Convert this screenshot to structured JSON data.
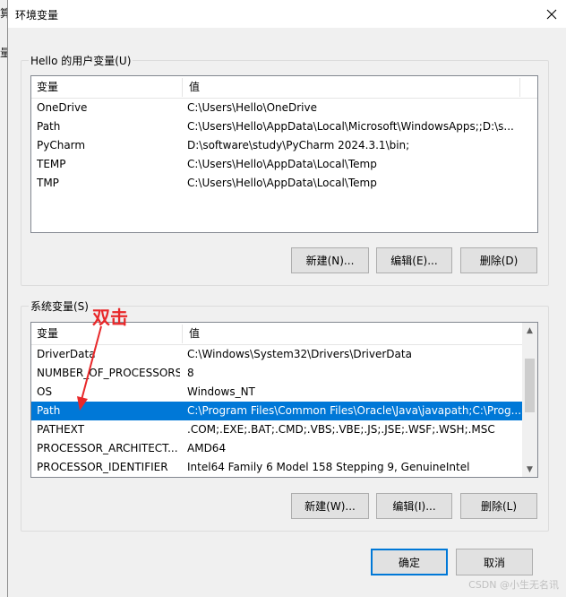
{
  "dialog": {
    "title": "环境变量",
    "ok_label": "确定",
    "cancel_label": "取消"
  },
  "background": {
    "glyph_1": "算",
    "glyph_2": "量"
  },
  "user_vars": {
    "group_label": "Hello 的用户变量(U)",
    "columns": [
      "变量",
      "值"
    ],
    "rows": [
      {
        "name": "OneDrive",
        "value": "C:\\Users\\Hello\\OneDrive"
      },
      {
        "name": "Path",
        "value": "C:\\Users\\Hello\\AppData\\Local\\Microsoft\\WindowsApps;;D:\\s..."
      },
      {
        "name": "PyCharm",
        "value": "D:\\software\\study\\PyCharm 2024.3.1\\bin;"
      },
      {
        "name": "TEMP",
        "value": "C:\\Users\\Hello\\AppData\\Local\\Temp"
      },
      {
        "name": "TMP",
        "value": "C:\\Users\\Hello\\AppData\\Local\\Temp"
      }
    ],
    "new_label": "新建(N)...",
    "edit_label": "编辑(E)...",
    "delete_label": "删除(D)"
  },
  "system_vars": {
    "group_label": "系统变量(S)",
    "columns": [
      "变量",
      "值"
    ],
    "rows": [
      {
        "name": "DriverData",
        "value": "C:\\Windows\\System32\\Drivers\\DriverData"
      },
      {
        "name": "NUMBER_OF_PROCESSORS",
        "value": "8"
      },
      {
        "name": "OS",
        "value": "Windows_NT"
      },
      {
        "name": "Path",
        "value": "C:\\Program Files\\Common Files\\Oracle\\Java\\javapath;C:\\Prog..."
      },
      {
        "name": "PATHEXT",
        "value": ".COM;.EXE;.BAT;.CMD;.VBS;.VBE;.JS;.JSE;.WSF;.WSH;.MSC"
      },
      {
        "name": "PROCESSOR_ARCHITECT...",
        "value": "AMD64"
      },
      {
        "name": "PROCESSOR_IDENTIFIER",
        "value": "Intel64 Family 6 Model 158 Stepping 9, GenuineIntel"
      }
    ],
    "selected_index": 3,
    "new_label": "新建(W)...",
    "edit_label": "编辑(I)...",
    "delete_label": "删除(L)"
  },
  "annotation": {
    "text": "双击",
    "color": "#e8282a"
  },
  "watermark": "CSDN @小生无名讯",
  "colors": {
    "selection": "#0078d7",
    "primary_border": "#0078d7"
  }
}
